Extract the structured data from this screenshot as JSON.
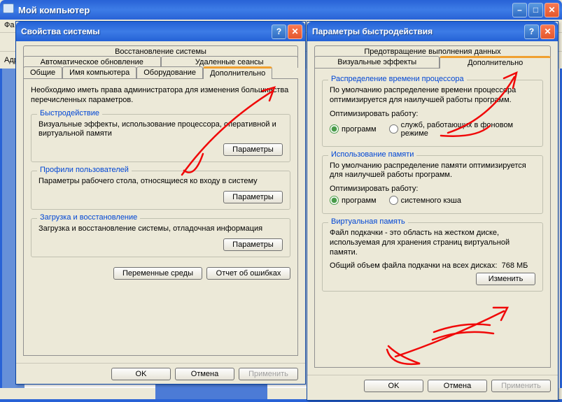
{
  "mycomputer": {
    "title": "Мой компьютер",
    "menu_file_char": "Фа",
    "address_label_char": "Адр"
  },
  "sysprops": {
    "title": "Свойства системы",
    "tabs_back": [
      "Восстановление системы"
    ],
    "tabs_back2": [
      "Автоматическое обновление",
      "Удаленные сеансы"
    ],
    "tabs_front": [
      "Общие",
      "Имя компьютера",
      "Оборудование",
      "Дополнительно"
    ],
    "intro": "Необходимо иметь права администратора для изменения большинства перечисленных параметров.",
    "perf": {
      "legend": "Быстродействие",
      "desc": "Визуальные эффекты, использование процессора, оперативной и виртуальной памяти",
      "btn": "Параметры"
    },
    "profiles": {
      "legend": "Профили пользователей",
      "desc": "Параметры рабочего стола, относящиеся ко входу в систему",
      "btn": "Параметры"
    },
    "startup": {
      "legend": "Загрузка и восстановление",
      "desc": "Загрузка и восстановление системы, отладочная информация",
      "btn": "Параметры"
    },
    "env_btn": "Переменные среды",
    "err_btn": "Отчет об ошибках",
    "ok": "OK",
    "cancel": "Отмена",
    "apply": "Применить"
  },
  "perfopts": {
    "title": "Параметры быстродействия",
    "tabs_back": [
      "Предотвращение выполнения данных"
    ],
    "tabs_front": [
      "Визуальные эффекты",
      "Дополнительно"
    ],
    "cpu": {
      "legend": "Распределение времени процессора",
      "desc": "По умолчанию распределение времени процессора оптимизируется для наилучшей работы программ.",
      "optimize": "Оптимизировать работу:",
      "opt1": "программ",
      "opt2": "служб, работающих в фоновом режиме"
    },
    "mem": {
      "legend": "Использование памяти",
      "desc": "По умолчанию распределение памяти оптимизируется для наилучшей работы программ.",
      "optimize": "Оптимизировать работу:",
      "opt1": "программ",
      "opt2": "системного кэша"
    },
    "vmem": {
      "legend": "Виртуальная память",
      "desc": "Файл подкачки - это область на жестком диске, используемая для хранения страниц виртуальной памяти.",
      "total_label": "Общий объем файла подкачки на всех дисках:",
      "total_value": "768 МБ",
      "btn": "Изменить"
    },
    "ok": "OK",
    "cancel": "Отмена",
    "apply": "Применить"
  }
}
